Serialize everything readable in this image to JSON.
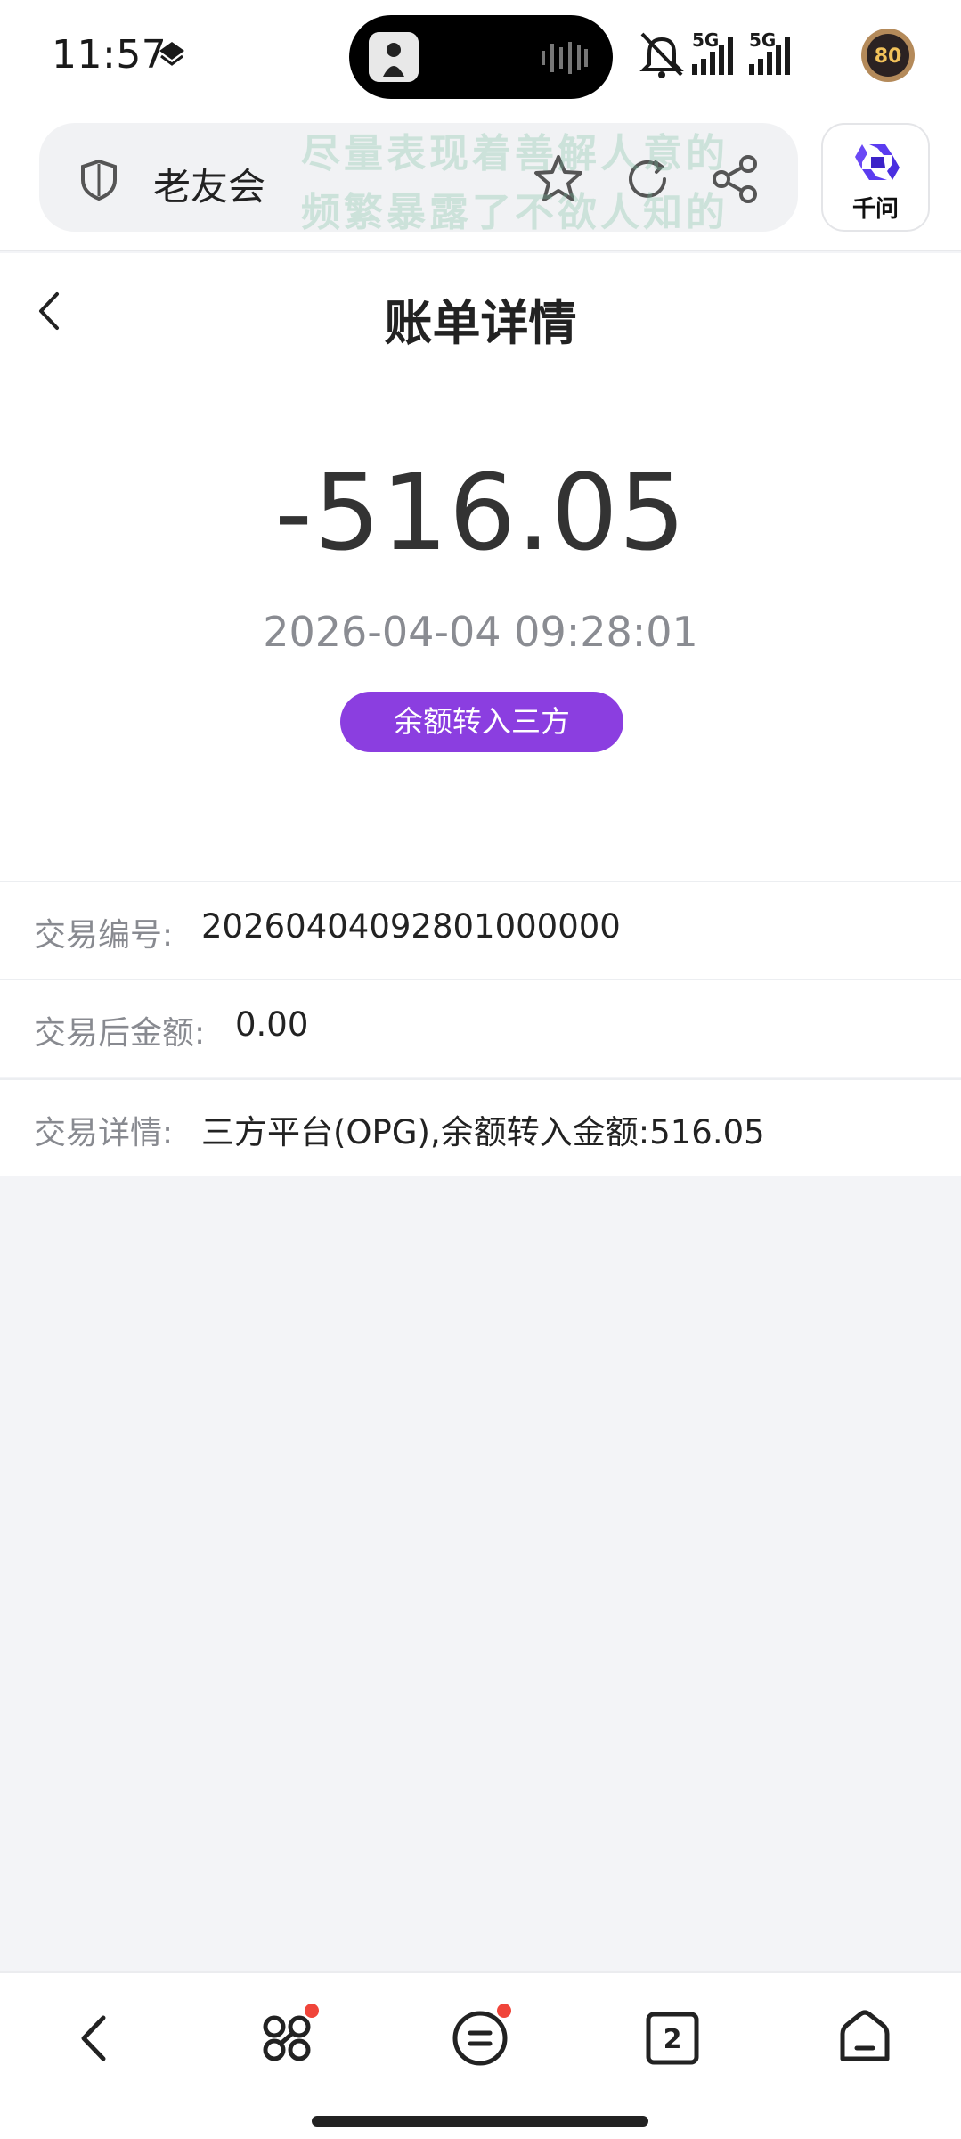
{
  "status": {
    "time": "11:57",
    "network_1": "5G",
    "network_2": "5G",
    "battery": "80"
  },
  "browser": {
    "site_name": "老友会",
    "watermark_line1": "尽量表现着善解人意的",
    "watermark_line2": "频繁暴露了不欲人知的",
    "assistant_label": "千问"
  },
  "page": {
    "title": "账单详情"
  },
  "summary": {
    "amount": "-516.05",
    "datetime": "2026-04-04 09:28:01",
    "type": "余额转入三方"
  },
  "details": [
    {
      "label": "交易编号:",
      "value": "20260404092801000000"
    },
    {
      "label": "交易后金额:",
      "value": "0.00"
    },
    {
      "label": "交易详情:",
      "value": "三方平台(OPG),余额转入金额:516.05"
    }
  ],
  "nav": {
    "tabs_count": "2"
  },
  "colors": {
    "accent": "#8b3ee0",
    "badge_dot": "#f0453a"
  }
}
